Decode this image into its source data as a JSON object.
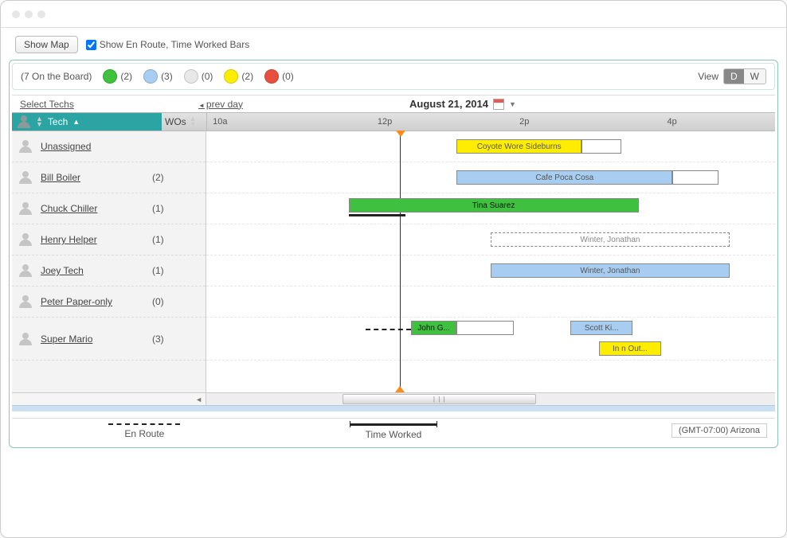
{
  "toolbar": {
    "show_map": "Show Map",
    "checkbox_label": "Show En Route, Time Worked Bars",
    "checked": true
  },
  "legend": {
    "board_count": "(7 On the Board)",
    "statuses": [
      {
        "color": "#3fc13f",
        "count": "(2)"
      },
      {
        "color": "#a7cdf0",
        "count": "(3)"
      },
      {
        "color": "#e8e8e8",
        "count": "(0)"
      },
      {
        "color": "#ffed00",
        "count": "(2)"
      },
      {
        "color": "#e84f3d",
        "count": "(0)"
      }
    ],
    "view_label": "View",
    "view_d": "D",
    "view_w": "W"
  },
  "dates": {
    "select_techs": "Select Techs",
    "prev_day": "prev day",
    "current": "August 21, 2014"
  },
  "columns": {
    "tech": "Tech",
    "wos": "WOs",
    "ticks": [
      "10a",
      "12p",
      "2p",
      "4p"
    ]
  },
  "techs": [
    {
      "name": "Unassigned",
      "wos": ""
    },
    {
      "name": "Bill Boiler",
      "wos": "(2)"
    },
    {
      "name": "Chuck Chiller",
      "wos": "(1)"
    },
    {
      "name": "Henry Helper",
      "wos": "(1)"
    },
    {
      "name": "Joey Tech",
      "wos": "(1)"
    },
    {
      "name": "Peter Paper-only",
      "wos": "(0)"
    },
    {
      "name": "Super Mario",
      "wos": "(3)"
    }
  ],
  "tasks": {
    "coyote": "Coyote Wore Sideburns",
    "cafe": "Cafe Poca Cosa",
    "tina": "Tina Suarez",
    "winter": "Winter, Jonathan",
    "john": "John G...",
    "scott": "Scott Ki...",
    "innout": "In n Out..."
  },
  "footer": {
    "enroute": "En Route",
    "worked": "Time Worked",
    "tz": "(GMT-07:00) Arizona"
  }
}
